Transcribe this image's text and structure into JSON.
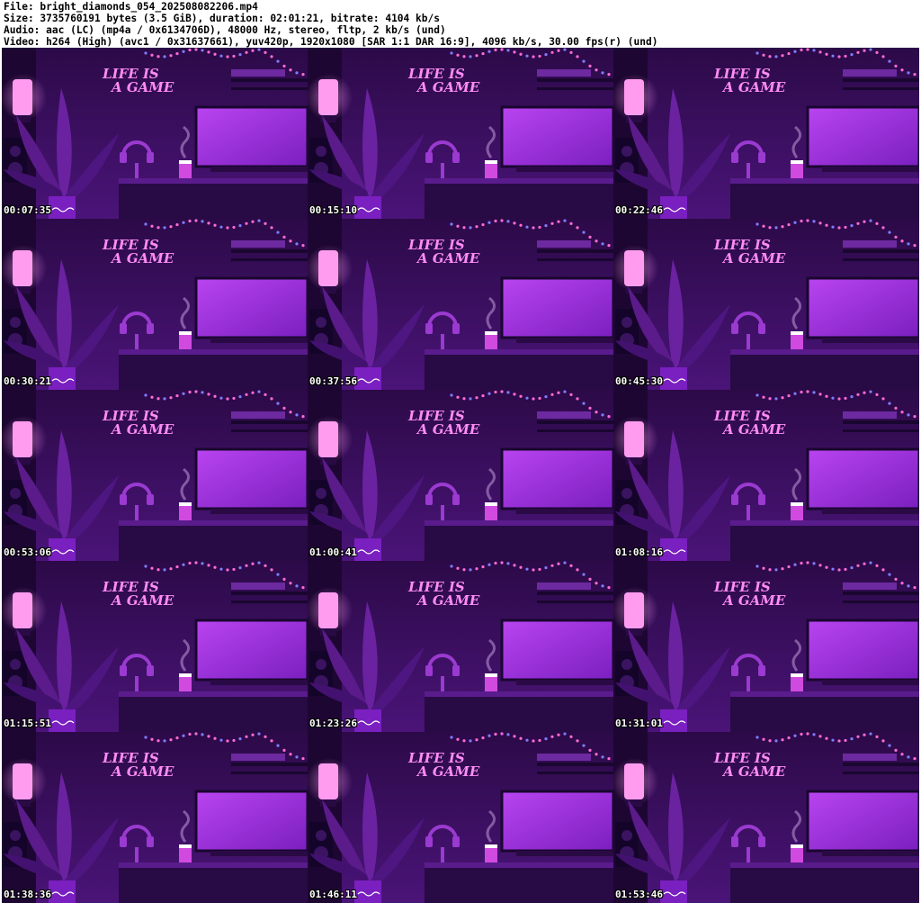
{
  "header": {
    "file": "File: bright_diamonds_054_202508082206.mp4",
    "size": "Size: 3735760191 bytes (3.5 GiB), duration: 02:01:21, bitrate: 4104 kb/s",
    "audio": "Audio: aac (LC) (mp4a / 0x6134706D), 48000 Hz, stereo, fltp, 2 kb/s (und)",
    "video": "Video: h264 (High) (avc1 / 0x31637661), yuv420p, 1920x1080 [SAR 1:1 DAR 16:9], 4096 kb/s, 30.00 fps(r) (und)"
  },
  "neon_sign": [
    "LIFE IS",
    "A GAME"
  ],
  "thumbnails": [
    {
      "timestamp": "00:07:35"
    },
    {
      "timestamp": "00:15:10"
    },
    {
      "timestamp": "00:22:46"
    },
    {
      "timestamp": "00:30:21"
    },
    {
      "timestamp": "00:37:56"
    },
    {
      "timestamp": "00:45:30"
    },
    {
      "timestamp": "00:53:06"
    },
    {
      "timestamp": "01:00:41"
    },
    {
      "timestamp": "01:08:16"
    },
    {
      "timestamp": "01:15:51"
    },
    {
      "timestamp": "01:23:26"
    },
    {
      "timestamp": "01:31:01"
    },
    {
      "timestamp": "01:38:36"
    },
    {
      "timestamp": "01:46:11"
    },
    {
      "timestamp": "01:53:46"
    }
  ],
  "colors": {
    "wall": "#3a0f5c",
    "neon": "#ff8cf5",
    "monitor": "#9b2fd6",
    "lamp": "#ff9cf0",
    "desk": "#5a1c8c"
  }
}
